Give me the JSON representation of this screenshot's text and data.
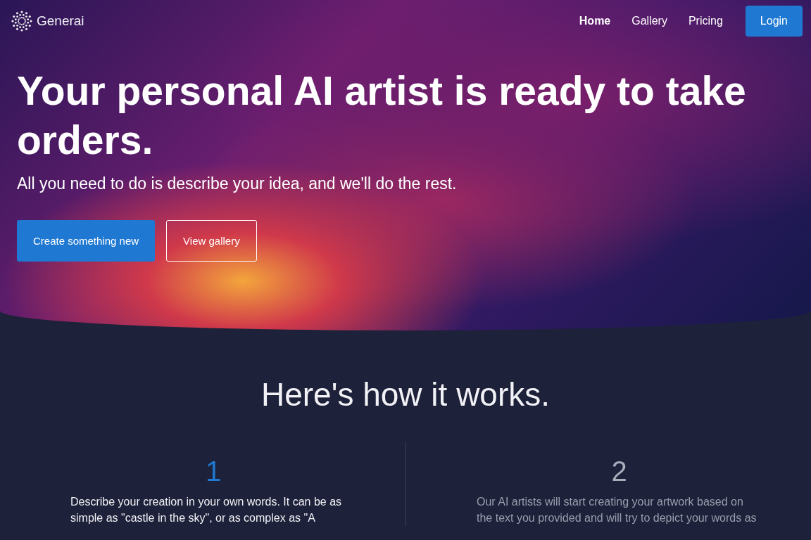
{
  "brand": {
    "name": "Generai"
  },
  "nav": {
    "links": [
      {
        "label": "Home",
        "selected": true
      },
      {
        "label": "Gallery",
        "selected": false
      },
      {
        "label": "Pricing",
        "selected": false
      }
    ],
    "login": "Login"
  },
  "hero": {
    "title": "Your personal AI artist is ready to take orders.",
    "subtitle": "All you need to do is describe your idea, and we'll do the rest.",
    "buttons": [
      {
        "label": "Create something new",
        "kind": "primary"
      },
      {
        "label": "View gallery",
        "kind": "outline"
      }
    ]
  },
  "how": {
    "title": "Here's how it works.",
    "steps": [
      {
        "number": "1",
        "selected": true,
        "text": "Describe your creation in your own words. It can be as simple as \"castle in the sky\", or as complex as \"A"
      },
      {
        "number": "2",
        "selected": false,
        "text": "Our AI artists will start creating your artwork based on the text you provided and will try to depict your words as"
      }
    ]
  }
}
